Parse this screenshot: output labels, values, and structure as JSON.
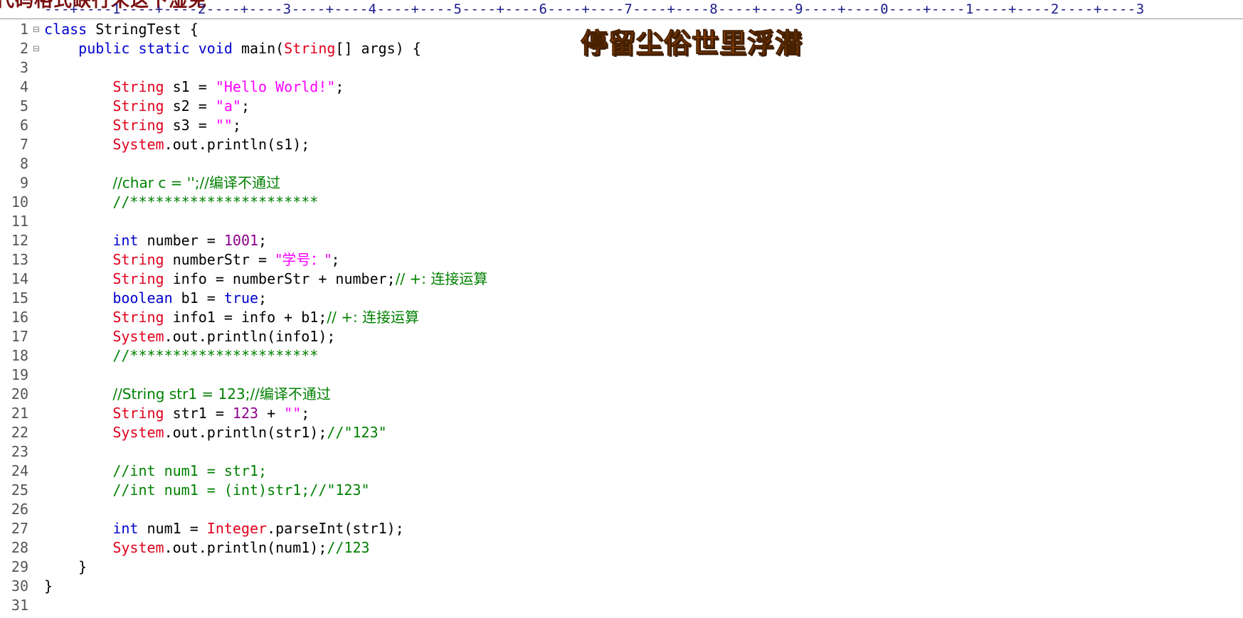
{
  "ruler": {
    "overlay_text": "代码格式缺行未这下湿免",
    "marks": [
      "1",
      "2",
      "3",
      "4",
      "5",
      "6",
      "7",
      "8",
      "9",
      "0",
      "1",
      "2",
      "3"
    ]
  },
  "watermark": {
    "text": "停留尘俗世里浮潜"
  },
  "gutter": {
    "line_numbers": [
      "1",
      "2",
      "3",
      "4",
      "5",
      "6",
      "7",
      "8",
      "9",
      "10",
      "11",
      "12",
      "13",
      "14",
      "15",
      "16",
      "17",
      "18",
      "19",
      "20",
      "21",
      "22",
      "23",
      "24",
      "25",
      "26",
      "27",
      "28",
      "29",
      "30",
      "31"
    ],
    "fold_icon": "⊟"
  },
  "code": {
    "l1": [
      "class ",
      "StringTest {"
    ],
    "l2": [
      "    ",
      "public static void ",
      "main(",
      "String",
      "[] args) {"
    ],
    "l4": [
      "        ",
      "String",
      " s1 = ",
      "\"Hello World!\"",
      ";"
    ],
    "l5": [
      "        ",
      "String",
      " s2 = ",
      "\"a\"",
      ";"
    ],
    "l6": [
      "        ",
      "String",
      " s3 = ",
      "\"\"",
      ";"
    ],
    "l7": [
      "        ",
      "System",
      ".out.println(s1);"
    ],
    "l9": [
      "        ",
      "//char c = '';//编译不通过"
    ],
    "l10": [
      "        ",
      "//**********************"
    ],
    "l12": [
      "        ",
      "int",
      " number = ",
      "1001",
      ";"
    ],
    "l13": [
      "        ",
      "String",
      " numberStr = ",
      "\"学号：\"",
      ";"
    ],
    "l14": [
      "        ",
      "String",
      " info = numberStr + number;",
      "// +: 连接运算"
    ],
    "l15": [
      "        ",
      "boolean",
      " b1 = ",
      "true",
      ";"
    ],
    "l16": [
      "        ",
      "String",
      " info1 = info + b1;",
      "// +: 连接运算"
    ],
    "l17": [
      "        ",
      "System",
      ".out.println(info1);"
    ],
    "l18": [
      "        ",
      "//**********************"
    ],
    "l20": [
      "        ",
      "//String str1 = 123;//编译不通过"
    ],
    "l21": [
      "        ",
      "String",
      " str1 = ",
      "123",
      " + ",
      "\"\"",
      ";"
    ],
    "l22": [
      "        ",
      "System",
      ".out.println(str1);",
      "//\"123\""
    ],
    "l24": [
      "        ",
      "//int num1 = str1;"
    ],
    "l25": [
      "        ",
      "//int num1 = (int)str1;//\"123\""
    ],
    "l27": [
      "        ",
      "int",
      " num1 = ",
      "Integer",
      ".parseInt(str1);"
    ],
    "l28": [
      "        ",
      "System",
      ".out.println(num1);",
      "//123"
    ],
    "l29": [
      "    ",
      "}"
    ],
    "l30": [
      "",
      "}"
    ]
  },
  "colors": {
    "keyword": "#0000cc",
    "type": "#e0001b",
    "string": "#ff00ff",
    "number": "#8b008b",
    "comment": "#008000"
  }
}
